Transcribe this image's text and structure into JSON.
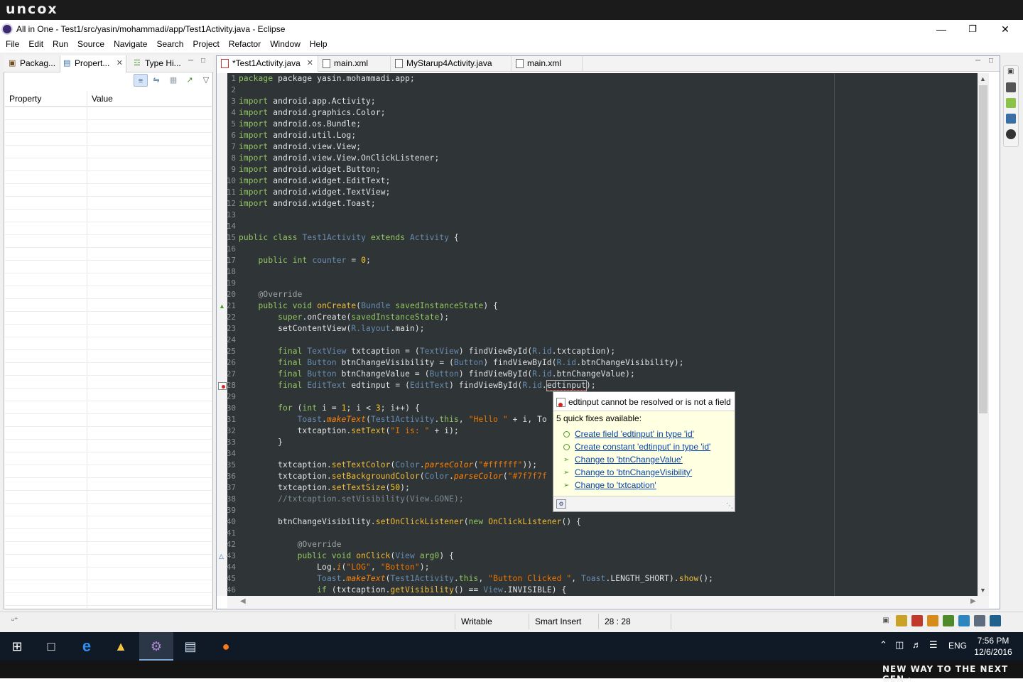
{
  "brand": {
    "logo_text": "uncox",
    "tagline": "NEW WAY TO THE NEXT GEN ›"
  },
  "window": {
    "title": "All in One - Test1/src/yasin/mohammadi/app/Test1Activity.java - Eclipse",
    "minimize": "—",
    "maximize": "❐",
    "close": "✕"
  },
  "menu": [
    "File",
    "Edit",
    "Run",
    "Source",
    "Navigate",
    "Search",
    "Project",
    "Refactor",
    "Window",
    "Help"
  ],
  "left_panel": {
    "tabs": [
      {
        "label": "Packag...",
        "icon": "package-explorer-icon"
      },
      {
        "label": "Propert...",
        "icon": "properties-icon",
        "active": true
      },
      {
        "label": "Type Hi...",
        "icon": "type-hierarchy-icon"
      }
    ],
    "close_glyph": "✕",
    "columns": {
      "property": "Property",
      "value": "Value"
    }
  },
  "editor": {
    "tabs": [
      {
        "label": "*Test1Activity.java",
        "icon": "java-file-error-icon",
        "active": true
      },
      {
        "label": "main.xml",
        "icon": "xml-file-icon"
      },
      {
        "label": "MyStarup4Activity.java",
        "icon": "java-file-icon"
      },
      {
        "label": "main.xml",
        "icon": "xml-file-icon"
      }
    ],
    "close_glyph": "✕",
    "line_numbers": [
      "1",
      "2",
      "3",
      "4",
      "5",
      "6",
      "7",
      "8",
      "9",
      "10",
      "11",
      "12",
      "13",
      "14",
      "15",
      "16",
      "17",
      "18",
      "19",
      "20",
      "21",
      "22",
      "23",
      "24",
      "25",
      "26",
      "27",
      "28",
      "29",
      "30",
      "31",
      "32",
      "33",
      "34",
      "35",
      "36",
      "37",
      "38",
      "39",
      "40",
      "41",
      "42",
      "43",
      "44",
      "45",
      "46"
    ],
    "code": {
      "l1": "package yasin.mohammadi.app;",
      "imports": [
        "android.app.Activity;",
        "android.graphics.Color;",
        "android.os.Bundle;",
        "android.util.Log;",
        "android.view.View;",
        "android.view.View.OnClickListener;",
        "android.widget.Button;",
        "android.widget.EditText;",
        "android.widget.TextView;",
        "android.widget.Toast;"
      ],
      "kw_import": "import",
      "kw_public": "public",
      "kw_class": "class",
      "kw_extends": "extends",
      "kw_int": "int",
      "kw_void": "void",
      "kw_final": "final",
      "kw_for": "for",
      "kw_new": "new",
      "kw_if": "if",
      "kw_super": "super",
      "kw_this": "this",
      "class_name": "Test1Activity",
      "parent_class": "Activity",
      "brace_open": "{",
      "field_counter": "counter",
      "field_init": " = ",
      "zero": "0",
      "semicolon": ";",
      "override": "@Override",
      "oncreate": "onCreate",
      "bundle": "Bundle",
      "saved": "savedInstanceState",
      "paren_close_brace": ") {",
      "set_content": "setContentView(",
      "r": "R",
      "layout": ".layout",
      "main_close": ".main);",
      "textview": "TextView",
      "button": "Button",
      "edittext": "EditText",
      "txtcaption": "txtcaption",
      "btn_vis": "btnChangeVisibility",
      "btn_val": "btnChangeValue",
      "edtinput": "edtinput",
      "find_view": "findViewById(",
      "id": ".id",
      "toast": "Toast",
      "make_text": "makeText",
      "hello": "\"Hello \"",
      "plus_i": " + i, To",
      "set_text": "setText",
      "i_is": "\"I is: \"",
      "plus_i_close": " + i);",
      "close_brace": "}",
      "set_text_color": "setTextColor",
      "color": "Color",
      "parse_color": "parseColor",
      "white": "\"#ffffff\"",
      "set_bg_color": "setBackgroundColor",
      "grey_hex": "\"#7f7f7f",
      "set_text_size": "setTextSize",
      "fifty": "50",
      "comment_gone": "//txtcaption.setVisibility(View.GONE);",
      "set_on_click": "setOnClickListener",
      "on_click_listener": "OnClickListener",
      "on_click": "onClick",
      "view": "View",
      "arg0": "arg0",
      "log": "Log.",
      "log_i": "i",
      "log_tag": "\"LOG\"",
      "botton": "\"Botton\"",
      "btn_clicked": "\"Button Clicked \"",
      "length_short": "LENGTH_SHORT",
      "show": "show",
      "get_visibility": "getVisibility",
      "invisible": "INVISIBLE",
      "one": "1",
      "three": "3"
    }
  },
  "quickfix": {
    "problem": "edtinput cannot be resolved or is not a field",
    "count_label": "5 quick fixes available:",
    "fixes": [
      {
        "label": "Create field 'edtinput' in type 'id'",
        "icon": "create-field-icon"
      },
      {
        "label": "Create constant 'edtinput' in type 'id'",
        "icon": "create-constant-icon"
      },
      {
        "label": "Change to 'btnChangeValue'",
        "icon": "change-to-icon"
      },
      {
        "label": "Change to 'btnChangeVisibility'",
        "icon": "change-to-icon"
      },
      {
        "label": "Change to 'txtcaption'",
        "icon": "change-to-icon"
      }
    ]
  },
  "status": {
    "writable": "Writable",
    "insert_mode": "Smart Insert",
    "position": "28 : 28"
  },
  "taskbar": {
    "time": "7:56 PM",
    "date": "12/6/2016",
    "language": "ENG"
  },
  "colors": {
    "editor_bg": "#2f3436",
    "keyword": "#93c763",
    "type": "#678cb1",
    "method": "#f0bd3a",
    "string": "#ec7600",
    "quickfix_bg": "#ffffe1",
    "taskbar_bg": "#101a27"
  }
}
